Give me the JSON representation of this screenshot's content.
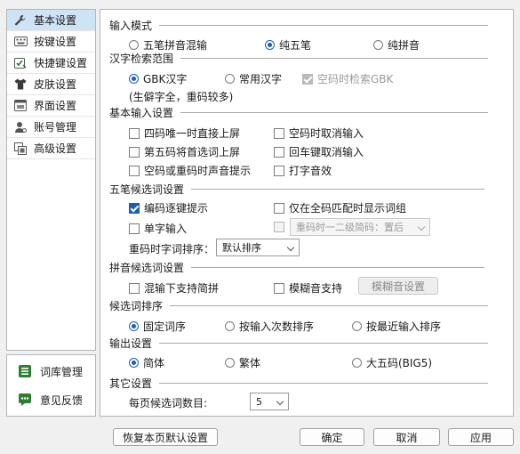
{
  "sidebar": {
    "items": [
      {
        "label": "基本设置",
        "icon": "wrench-icon"
      },
      {
        "label": "按键设置",
        "icon": "keyboard-icon"
      },
      {
        "label": "快捷键设置",
        "icon": "shortcut-icon"
      },
      {
        "label": "皮肤设置",
        "icon": "shirt-icon"
      },
      {
        "label": "界面设置",
        "icon": "window-icon"
      },
      {
        "label": "账号管理",
        "icon": "user-icon"
      },
      {
        "label": "高级设置",
        "icon": "advanced-icon"
      }
    ],
    "bottom": [
      {
        "label": "词库管理",
        "icon": "dictionary-icon"
      },
      {
        "label": "意见反馈",
        "icon": "feedback-icon"
      }
    ]
  },
  "input_mode": {
    "title": "输入模式",
    "options": [
      "五笔拼音混输",
      "纯五笔",
      "纯拼音"
    ],
    "selected": "纯五笔"
  },
  "charset": {
    "title": "汉字检索范围",
    "options": [
      "GBK汉字",
      "常用汉字"
    ],
    "selected": "GBK汉字",
    "empty_code_gbk": "空码时检索GBK",
    "note": "(生僻字全，重码较多)"
  },
  "basic_input": {
    "title": "基本输入设置",
    "options": [
      {
        "label": "四码唯一时直接上屏",
        "checked": false
      },
      {
        "label": "空码时取消输入",
        "checked": false
      },
      {
        "label": "第五码将首选词上屏",
        "checked": false
      },
      {
        "label": "回车键取消输入",
        "checked": false
      },
      {
        "label": "空码或重码时声音提示",
        "checked": false
      },
      {
        "label": "打字音效",
        "checked": false
      }
    ]
  },
  "wubi_candidates": {
    "title": "五笔候选词设置",
    "code_hint": "编码逐键提示",
    "full_code_only": "仅在全码匹配时显示词组",
    "single_char": "单字输入",
    "second_level": "重码时一二级简码：置后",
    "sort_label": "重码时字词排序：",
    "sort_value": "默认排序"
  },
  "pinyin_candidates": {
    "title": "拼音候选词设置",
    "mixed_abbr": "混输下支持简拼",
    "fuzzy": "模糊音支持",
    "fuzzy_button": "模糊音设置"
  },
  "candidate_order": {
    "title": "候选词排序",
    "options": [
      "固定词序",
      "按输入次数排序",
      "按最近输入排序"
    ],
    "selected": "固定词序"
  },
  "output": {
    "title": "输出设置",
    "options": [
      "简体",
      "繁体",
      "大五码(BIG5)"
    ],
    "selected": "简体"
  },
  "other": {
    "title": "其它设置",
    "per_page_label": "每页候选词数目:",
    "per_page_value": "5"
  },
  "footer": {
    "restore": "恢复本页默认设置",
    "ok": "确定",
    "cancel": "取消",
    "apply": "应用"
  },
  "colors": {
    "accent": "#1a5fb4",
    "sidebar_selected": "#cfe3f7"
  }
}
